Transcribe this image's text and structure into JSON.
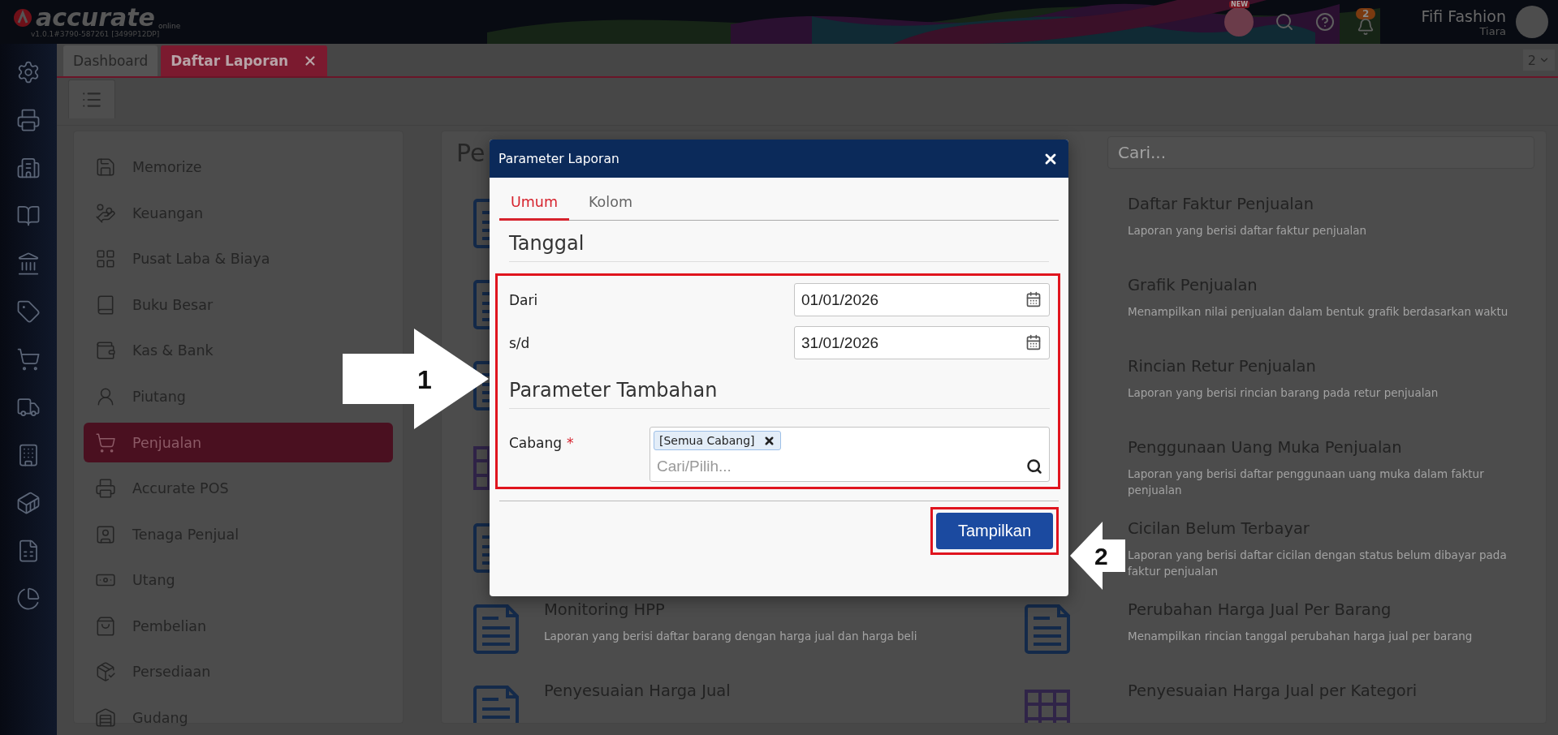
{
  "topbar": {
    "logo": "accurate",
    "logo_sub": "online",
    "version": "v1.0.1#3790-587261 [3499P12DP]",
    "new_badge": "NEW",
    "notification_count": "2",
    "user_name": "Fifi Fashion",
    "user_role": "Tiara"
  },
  "tabs": [
    {
      "label": "Dashboard",
      "selected": false,
      "closable": false
    },
    {
      "label": "Daftar Laporan",
      "selected": true,
      "closable": true
    }
  ],
  "tab_pager": "2",
  "menu": {
    "items": [
      {
        "label": "Memorize",
        "selected": false
      },
      {
        "label": "Keuangan",
        "selected": false
      },
      {
        "label": "Pusat Laba & Biaya",
        "selected": false
      },
      {
        "label": "Buku Besar",
        "selected": false
      },
      {
        "label": "Kas & Bank",
        "selected": false
      },
      {
        "label": "Piutang",
        "selected": false
      },
      {
        "label": "Penjualan",
        "selected": true
      },
      {
        "label": "Accurate POS",
        "selected": false
      },
      {
        "label": "Tenaga Penjual",
        "selected": false
      },
      {
        "label": "Utang",
        "selected": false
      },
      {
        "label": "Pembelian",
        "selected": false
      },
      {
        "label": "Persediaan",
        "selected": false
      },
      {
        "label": "Gudang",
        "selected": false
      }
    ]
  },
  "reports": {
    "heading": "Pe",
    "search": {
      "placeholder": "Cari..."
    },
    "rows": [
      {
        "left": {
          "kind": "doc"
        },
        "right": {
          "title": "Daftar Faktur Penjualan",
          "description": "Laporan yang berisi daftar faktur penjualan"
        }
      },
      {
        "left": {
          "kind": "doc"
        },
        "right": {
          "title": "Grafik Penjualan",
          "description": "Menampilkan nilai penjualan dalam bentuk grafik berdasarkan waktu"
        }
      },
      {
        "left": {
          "kind": "doc"
        },
        "right": {
          "title": "Rincian Retur Penjualan",
          "description": "Laporan yang berisi rincian barang pada retur penjualan"
        }
      },
      {
        "left": {
          "kind": "table"
        },
        "right": {
          "title": "Penggunaan Uang Muka Penjualan",
          "description": "Laporan yang berisi daftar penggunaan uang muka dalam faktur penjualan"
        }
      },
      {
        "left": {
          "kind": "doc"
        },
        "right": {
          "title": "Cicilan Belum Terbayar",
          "description": "Laporan yang berisi daftar cicilan dengan status belum dibayar pada faktur penjualan"
        }
      },
      {
        "left": {
          "kind": "doc",
          "title": "Monitoring HPP",
          "description": "Laporan yang berisi daftar barang dengan harga jual dan harga beli"
        },
        "right": {
          "kind": "doc",
          "title": "Perubahan Harga Jual Per Barang",
          "description": "Menampilkan rincian tanggal perubahan harga jual per barang"
        }
      },
      {
        "left": {
          "kind": "doc",
          "title": "Penyesuaian Harga Jual"
        },
        "right": {
          "kind": "table",
          "title": "Penyesuaian Harga Jual per Kategori"
        }
      }
    ]
  },
  "dialog": {
    "title": "Parameter Laporan",
    "tabs": [
      {
        "label": "Umum",
        "selected": true
      },
      {
        "label": "Kolom",
        "selected": false
      }
    ],
    "date_section": "Tanggal",
    "dates": [
      {
        "label": "Dari",
        "value": "01/01/2026"
      },
      {
        "label": "s/d",
        "value": "31/01/2026"
      }
    ],
    "extra_section": "Parameter Tambahan",
    "branch": {
      "label": "Cabang",
      "required_mark": "*",
      "tags": [
        "[Semua Cabang]"
      ],
      "placeholder": "Cari/Pilih..."
    },
    "submit": "Tampilkan"
  },
  "callouts": [
    {
      "number": "1"
    },
    {
      "number": "2"
    }
  ]
}
